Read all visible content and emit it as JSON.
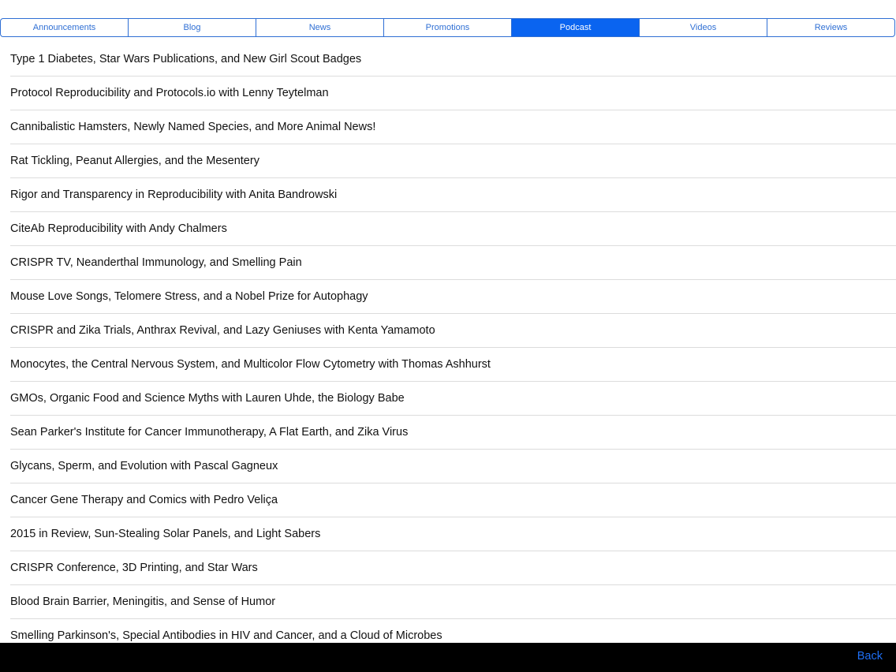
{
  "tabs": [
    {
      "label": "Announcements",
      "selected": false
    },
    {
      "label": "Blog",
      "selected": false
    },
    {
      "label": "News",
      "selected": false
    },
    {
      "label": "Promotions",
      "selected": false
    },
    {
      "label": "Podcast",
      "selected": true
    },
    {
      "label": "Videos",
      "selected": false
    },
    {
      "label": "Reviews",
      "selected": false
    }
  ],
  "episodes": [
    "Type 1 Diabetes, Star Wars Publications, and New Girl Scout Badges",
    "Protocol Reproducibility and Protocols.io with Lenny Teytelman",
    "Cannibalistic Hamsters, Newly Named Species, and More Animal News!",
    "Rat Tickling, Peanut Allergies, and the Mesentery",
    "Rigor and Transparency in Reproducibility with Anita Bandrowski",
    "CiteAb Reproducibility with Andy Chalmers",
    "CRISPR TV, Neanderthal Immunology, and Smelling Pain",
    "Mouse Love Songs, Telomere Stress, and a Nobel Prize for Autophagy",
    "CRISPR and Zika Trials, Anthrax Revival, and Lazy Geniuses with Kenta Yamamoto",
    "Monocytes, the Central Nervous System, and Multicolor Flow Cytometry with Thomas Ashhurst",
    "GMOs, Organic Food and Science Myths with Lauren Uhde, the Biology Babe",
    "Sean Parker's Institute for Cancer Immunotherapy, A Flat Earth, and Zika Virus",
    "Glycans, Sperm, and Evolution with Pascal Gagneux",
    "Cancer Gene Therapy and Comics with Pedro Veliça",
    "2015 in Review, Sun-Stealing Solar Panels, and Light Sabers",
    "CRISPR Conference, 3D Printing, and Star Wars",
    "Blood Brain Barrier, Meningitis, and Sense of Humor",
    "Smelling Parkinson's, Special Antibodies in HIV and Cancer, and a Cloud of Microbes"
  ],
  "toolbar": {
    "back_label": "Back"
  },
  "colors": {
    "accent": "#2f6fd4",
    "selected_tab_bg": "#0a64f0",
    "bottom_bar": "#000000",
    "back_link": "#1e6ff5"
  }
}
